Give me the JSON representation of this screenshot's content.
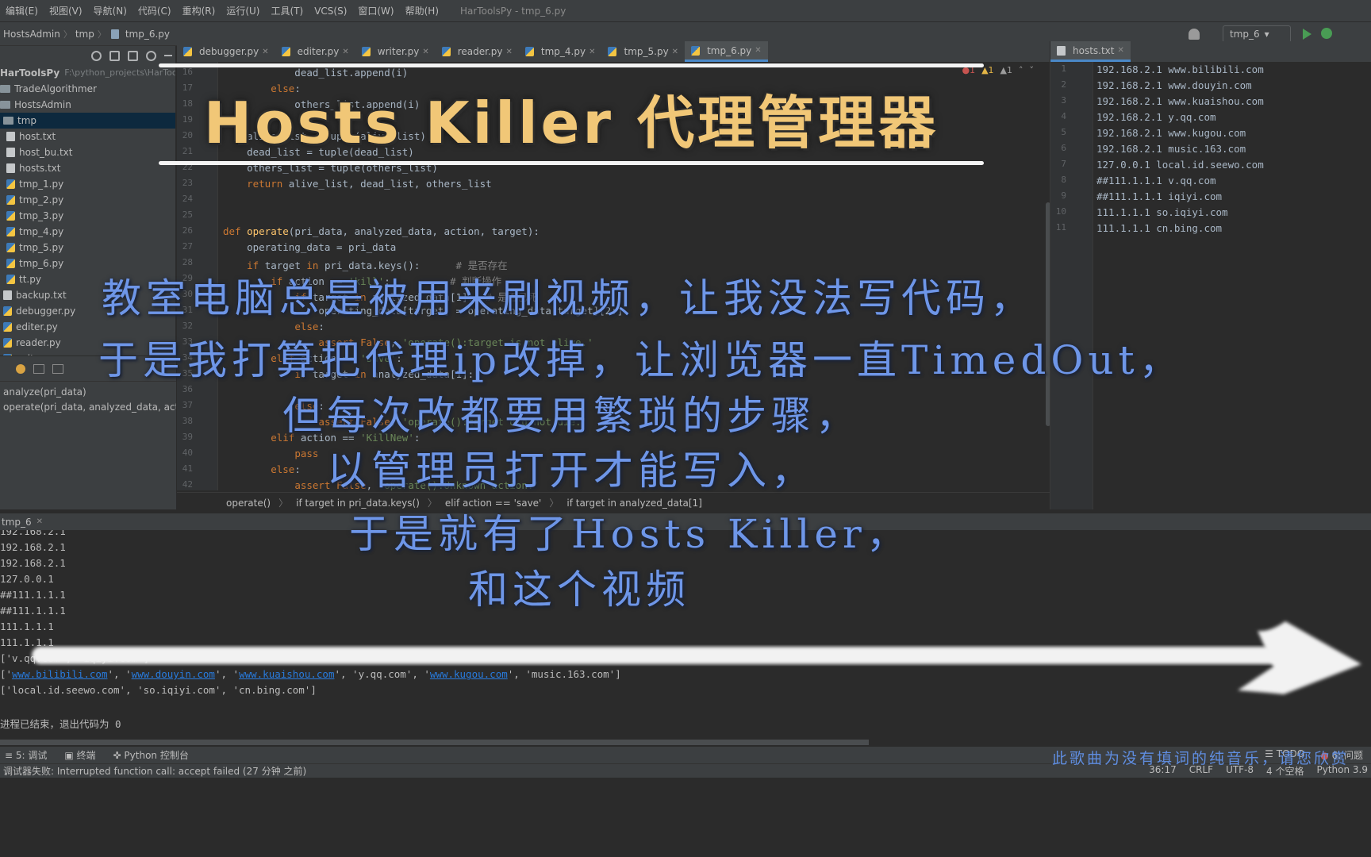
{
  "menu": {
    "items": [
      "编辑(E)",
      "视图(V)",
      "导航(N)",
      "代码(C)",
      "重构(R)",
      "运行(U)",
      "工具(T)",
      "VCS(S)",
      "窗口(W)",
      "帮助(H)"
    ],
    "window_title": "HarToolsPy - tmp_6.py"
  },
  "nav": {
    "crumbs": [
      "HostsAdmin",
      "tmp",
      "tmp_6.py"
    ],
    "run_config": "tmp_6"
  },
  "project": {
    "root_label": "HarToolsPy",
    "root_path": "F:\\python_projects\\HarToolsPy",
    "items": [
      {
        "label": "TradeAlgorithmer",
        "icon": "folder-icon",
        "indent": 0
      },
      {
        "label": "HostsAdmin",
        "icon": "folder-icon",
        "indent": 0
      },
      {
        "label": "tmp",
        "icon": "folder-icon",
        "indent": 1,
        "selected": true
      },
      {
        "label": "host.txt",
        "icon": "text-file-icon",
        "indent": 2
      },
      {
        "label": "host_bu.txt",
        "icon": "text-file-icon",
        "indent": 2
      },
      {
        "label": "hosts.txt",
        "icon": "text-file-icon",
        "indent": 2
      },
      {
        "label": "tmp_1.py",
        "icon": "python-file-icon",
        "indent": 2
      },
      {
        "label": "tmp_2.py",
        "icon": "python-file-icon",
        "indent": 2
      },
      {
        "label": "tmp_3.py",
        "icon": "python-file-icon",
        "indent": 2
      },
      {
        "label": "tmp_4.py",
        "icon": "python-file-icon",
        "indent": 2
      },
      {
        "label": "tmp_5.py",
        "icon": "python-file-icon",
        "indent": 2
      },
      {
        "label": "tmp_6.py",
        "icon": "python-file-icon",
        "indent": 2
      },
      {
        "label": "tt.py",
        "icon": "python-file-icon",
        "indent": 2
      },
      {
        "label": "backup.txt",
        "icon": "text-file-icon",
        "indent": 1
      },
      {
        "label": "debugger.py",
        "icon": "python-file-icon",
        "indent": 1
      },
      {
        "label": "editer.py",
        "icon": "python-file-icon",
        "indent": 1
      },
      {
        "label": "reader.py",
        "icon": "python-file-icon",
        "indent": 1
      },
      {
        "label": "writer.py",
        "icon": "python-file-icon",
        "indent": 1
      }
    ]
  },
  "structure": {
    "items": [
      "analyze(pri_data)",
      "operate(pri_data, analyzed_data, action, target)"
    ]
  },
  "tabs": [
    {
      "label": "debugger.py",
      "active": false
    },
    {
      "label": "editer.py",
      "active": false
    },
    {
      "label": "writer.py",
      "active": false
    },
    {
      "label": "reader.py",
      "active": false
    },
    {
      "label": "tmp_4.py",
      "active": false
    },
    {
      "label": "tmp_5.py",
      "active": false
    },
    {
      "label": "tmp_6.py",
      "active": true
    }
  ],
  "inspection": {
    "errors": "1",
    "warnings": "1",
    "weak": "1"
  },
  "code_lines": [
    {
      "n": "16",
      "text": "            dead_list.append(i)"
    },
    {
      "n": "17",
      "text": "        else:"
    },
    {
      "n": "18",
      "text": "            others_list.append(i)"
    },
    {
      "n": "19",
      "text": ""
    },
    {
      "n": "20",
      "text": "    alive_list = tuple(alive_list)"
    },
    {
      "n": "21",
      "text": "    dead_list = tuple(dead_list)"
    },
    {
      "n": "22",
      "text": "    others_list = tuple(others_list)"
    },
    {
      "n": "23",
      "text": "    return alive_list, dead_list, others_list"
    },
    {
      "n": "24",
      "text": ""
    },
    {
      "n": "25",
      "text": ""
    },
    {
      "n": "26",
      "text": "def operate(pri_data, analyzed_data, action, target):"
    },
    {
      "n": "27",
      "text": "    operating_data = pri_data"
    },
    {
      "n": "28",
      "text": "    if target in pri_data.keys():      # 是否存在"
    },
    {
      "n": "29",
      "text": "        if action == 'kill':          # 判断操作"
    },
    {
      "n": "30",
      "text": "            if target in analyzed_data[1]:  # 是否已死"
    },
    {
      "n": "31",
      "text": "                operating_data[target] = operating_data[target][2:]"
    },
    {
      "n": "32",
      "text": "            else:"
    },
    {
      "n": "33",
      "text": "                assert False, 'operate():target is not alive.'"
    },
    {
      "n": "34",
      "text": "        elif action == 'save':"
    },
    {
      "n": "35",
      "text": "            if target in analyzed_data[1]:"
    },
    {
      "n": "36",
      "text": "                "
    },
    {
      "n": "37",
      "text": "            else:"
    },
    {
      "n": "38",
      "text": "                assert False, 'operate():target did not die.'"
    },
    {
      "n": "39",
      "text": "        elif action == 'KillNew':"
    },
    {
      "n": "40",
      "text": "            pass"
    },
    {
      "n": "41",
      "text": "        else:"
    },
    {
      "n": "42",
      "text": "            assert False, 'operate():Unknown action.'"
    }
  ],
  "breadcrumb": [
    "operate()",
    "if target in pri_data.keys()",
    "elif action == 'save'",
    "if target in analyzed_data[1]"
  ],
  "right_editor": {
    "tab": "hosts.txt",
    "lines": [
      {
        "n": "1",
        "text": "192.168.2.1 www.bilibili.com"
      },
      {
        "n": "2",
        "text": "192.168.2.1 www.douyin.com"
      },
      {
        "n": "3",
        "text": "192.168.2.1 www.kuaishou.com"
      },
      {
        "n": "4",
        "text": "192.168.2.1 y.qq.com"
      },
      {
        "n": "5",
        "text": "192.168.2.1 www.kugou.com"
      },
      {
        "n": "6",
        "text": "192.168.2.1 music.163.com"
      },
      {
        "n": "7",
        "text": "127.0.0.1 local.id.seewo.com"
      },
      {
        "n": "8",
        "text": "##111.1.1.1 v.qq.com"
      },
      {
        "n": "9",
        "text": "##111.1.1.1 iqiyi.com"
      },
      {
        "n": "10",
        "text": "111.1.1.1 so.iqiyi.com"
      },
      {
        "n": "11",
        "text": "111.1.1.1 cn.bing.com"
      }
    ]
  },
  "run": {
    "tab": "tmp_6",
    "console_lines": [
      "192.168.2.1",
      "192.168.2.1",
      "192.168.2.1",
      "127.0.0.1",
      "##111.1.1.1",
      "##111.1.1.1",
      "111.1.1.1",
      "111.1.1.1",
      "['v.qq.com', 'iqiyi.com']"
    ],
    "alive_line": {
      "prefix": "['",
      "links": [
        "www.bilibili.com",
        "www.douyin.com",
        "www.kuaishou.com"
      ],
      "mid": "', 'y.qq.com', '",
      "link2": "www.kugou.com",
      "suffix": "', 'music.163.com']"
    },
    "others_line": "['local.id.seewo.com', 'so.iqiyi.com', 'cn.bing.com']",
    "exit_line": "进程已结束，退出代码为 0"
  },
  "toolwindows": {
    "left": [
      "5: 调试",
      "终端",
      "Python 控制台"
    ],
    "right": [
      "TODO",
      "6: 问题"
    ]
  },
  "status": {
    "message": "调试器失败: Interrupted function call: accept failed (27 分钟 之前)",
    "position": "36:17",
    "line_sep": "CRLF",
    "encoding": "UTF-8",
    "indent": "4 个空格",
    "interpreter": "Python 3.9"
  },
  "overlay": {
    "title": "Hosts Killer 代理管理器",
    "lines": [
      "教室电脑总是被用来刷视频，让我没法写代码，",
      "于是我打算把代理ip改掉，让浏览器一直TimedOut，",
      "但每次改都要用繁琐的步骤，",
      "以管理员打开才能写入，",
      "于是就有了Hosts Killer，",
      "和这个视频"
    ],
    "note": "此歌曲为没有填词的纯音乐，请您欣赏"
  },
  "colors": {
    "accent": "#4a88c7",
    "title_yellow": "#f1c777",
    "handwriting_blue": "#6e96e8",
    "link_blue": "#287bde"
  }
}
